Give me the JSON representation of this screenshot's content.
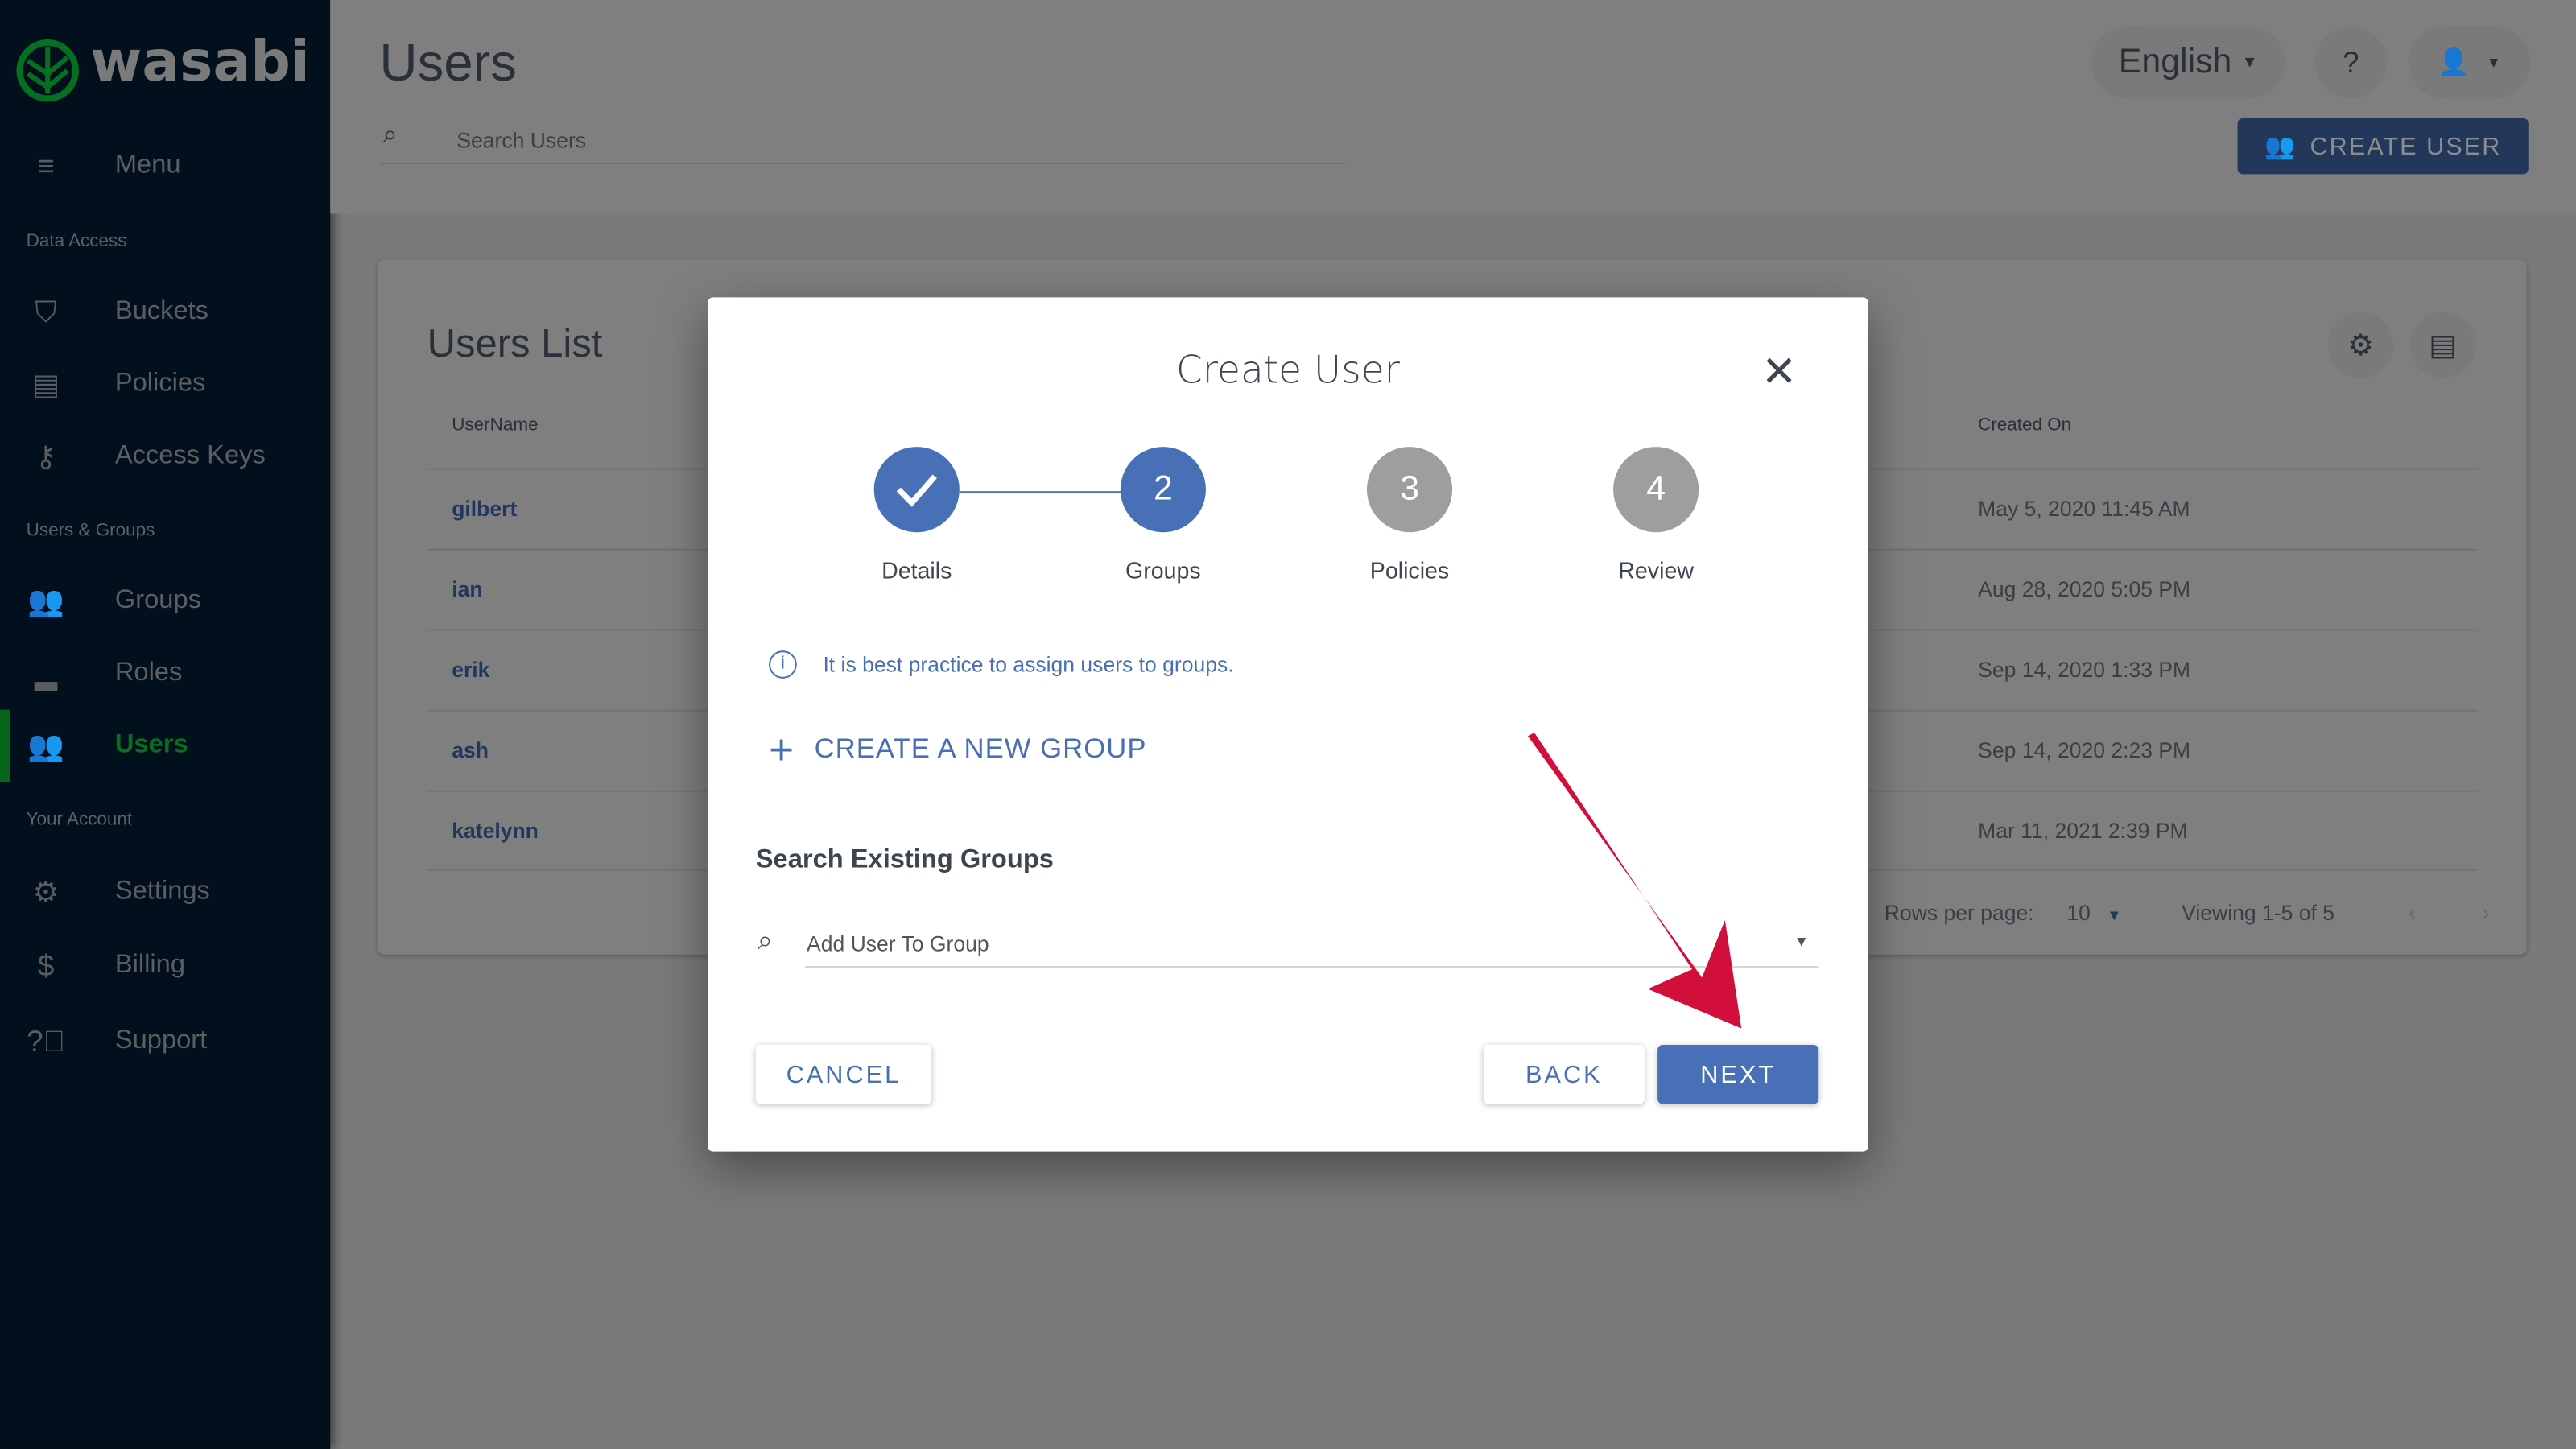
{
  "brand": {
    "name": "wasabi",
    "accent": "#05701f"
  },
  "sidebar": {
    "menu_label": "Menu",
    "sections": [
      {
        "title": "Data Access",
        "items": [
          {
            "label": "Buckets",
            "icon": "bucket-icon"
          },
          {
            "label": "Policies",
            "icon": "clipboard-icon"
          },
          {
            "label": "Access Keys",
            "icon": "key-icon"
          }
        ]
      },
      {
        "title": "Users & Groups",
        "items": [
          {
            "label": "Groups",
            "icon": "groups-icon"
          },
          {
            "label": "Roles",
            "icon": "hat-icon"
          },
          {
            "label": "Users",
            "icon": "users-icon",
            "active": true
          }
        ]
      },
      {
        "title": "Your Account",
        "items": [
          {
            "label": "Settings",
            "icon": "gear-icon"
          },
          {
            "label": "Billing",
            "icon": "dollar-icon"
          },
          {
            "label": "Support",
            "icon": "help-icon"
          }
        ]
      }
    ]
  },
  "header": {
    "title": "Users",
    "search_placeholder": "Search Users",
    "language": "English",
    "create_user_label": "CREATE USER"
  },
  "users_list": {
    "title": "Users List",
    "columns": [
      "UserName",
      "Created On"
    ],
    "rows": [
      {
        "username": "gilbert",
        "created_on": "May 5, 2020 11:45 AM"
      },
      {
        "username": "ian",
        "created_on": "Aug 28, 2020 5:05 PM"
      },
      {
        "username": "erik",
        "created_on": "Sep 14, 2020 1:33 PM"
      },
      {
        "username": "ash",
        "created_on": "Sep 14, 2020 2:23 PM"
      },
      {
        "username": "katelynn",
        "created_on": "Mar 11, 2021 2:39 PM"
      }
    ],
    "rows_per_page_label": "Rows per page:",
    "rows_per_page": "10",
    "viewing": "Viewing 1-5 of 5"
  },
  "modal": {
    "title": "Create User",
    "steps": [
      {
        "number": "1",
        "label": "Details",
        "state": "completed"
      },
      {
        "number": "2",
        "label": "Groups",
        "state": "active"
      },
      {
        "number": "3",
        "label": "Policies",
        "state": "pending"
      },
      {
        "number": "4",
        "label": "Review",
        "state": "pending"
      }
    ],
    "info_text": "It is best practice to assign users to groups.",
    "create_group_label": "CREATE A NEW GROUP",
    "search_heading": "Search Existing Groups",
    "search_placeholder": "Add User To Group",
    "cancel_label": "CANCEL",
    "back_label": "BACK",
    "next_label": "NEXT"
  },
  "colors": {
    "primary": "#4770b6",
    "pending": "#9e9e9e",
    "annotation_arrow": "#d10f3a"
  }
}
